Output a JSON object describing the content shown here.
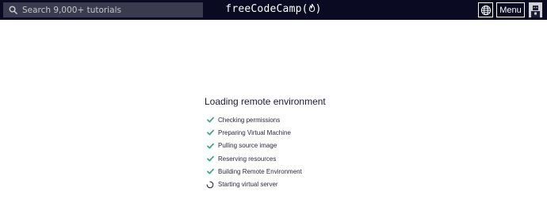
{
  "navbar": {
    "search_placeholder": "Search 9,000+ tutorials",
    "brand": "freeCodeCamp(🔥)",
    "brand_text": "freeCodeCamp(",
    "brand_close": ")",
    "menu_label": "Menu",
    "globe_icon": "globe-icon",
    "colors": {
      "background": "#0a0a23",
      "search_bg": "#3b3b4f"
    }
  },
  "loader": {
    "title": "Loading remote environment",
    "steps": [
      {
        "label": "Checking permissions",
        "status": "done"
      },
      {
        "label": "Preparing Virtual Machine",
        "status": "done"
      },
      {
        "label": "Pulling source image",
        "status": "done"
      },
      {
        "label": "Reserving resources",
        "status": "done"
      },
      {
        "label": "Building Remote Environment",
        "status": "done"
      },
      {
        "label": "Starting virtual server",
        "status": "loading"
      }
    ],
    "colors": {
      "check": "#2fa37a",
      "spinner": "#2a2a40"
    }
  }
}
